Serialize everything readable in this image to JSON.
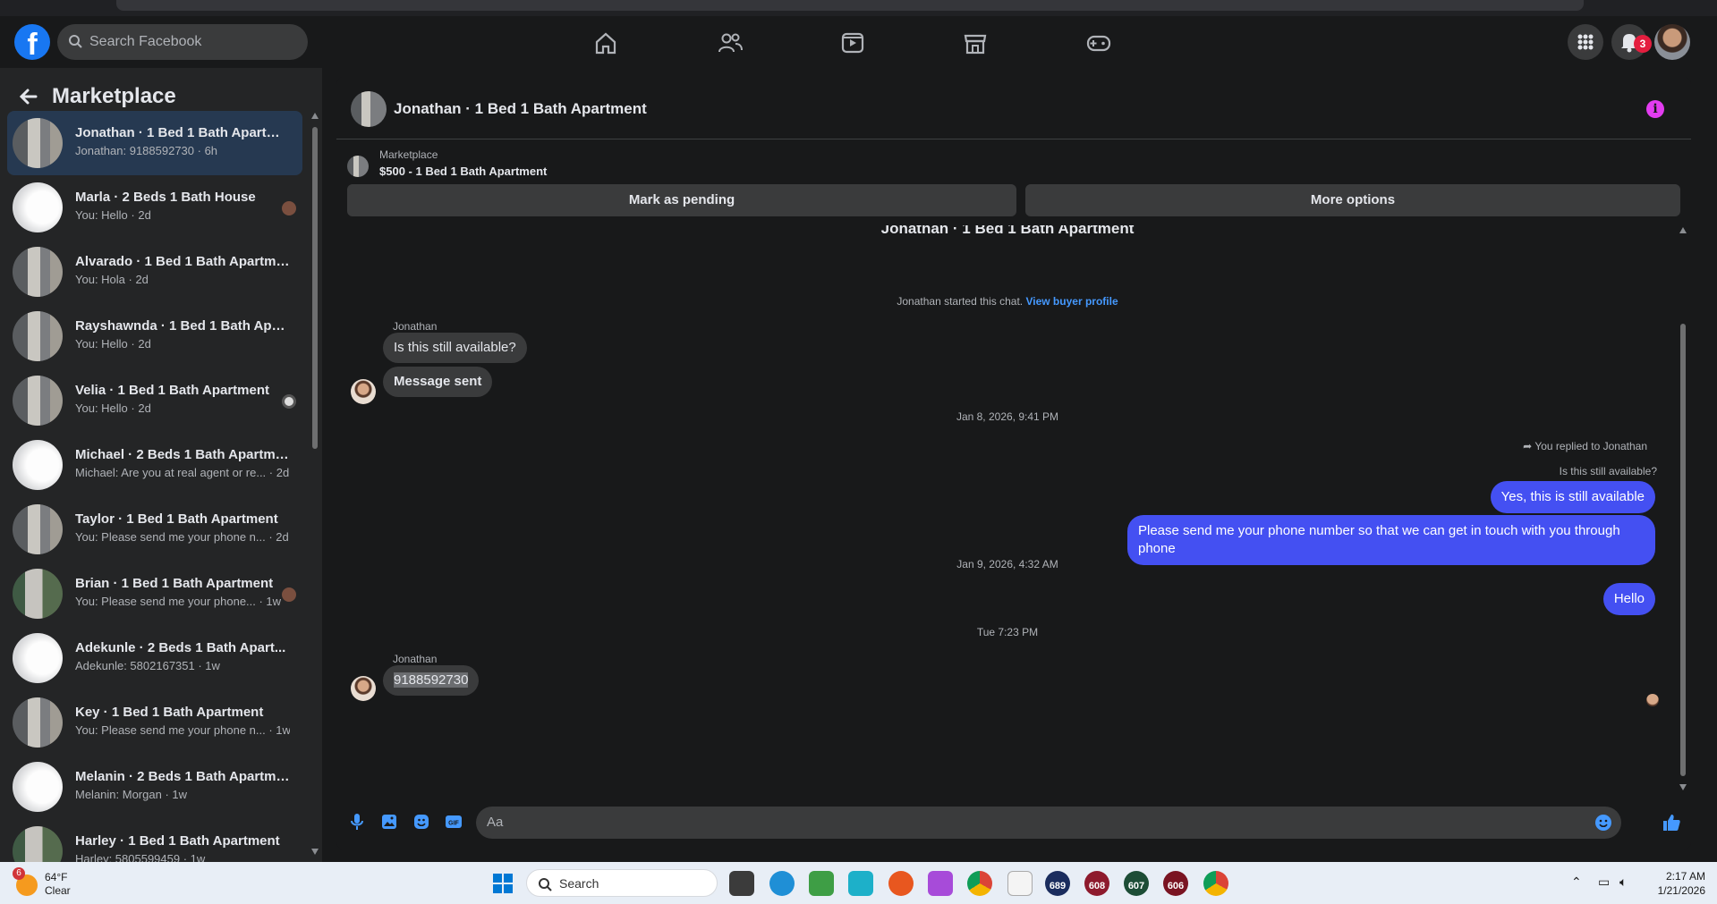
{
  "app": {
    "name": "Facebook Marketplace"
  },
  "topnav": {
    "search_placeholder": "Search Facebook",
    "notifications_count": "3"
  },
  "sidebar": {
    "title": "Marketplace",
    "conversations": [
      {
        "title": "Jonathan · 1 Bed 1 Bath Apartme...",
        "sub": "Jonathan: 9188592730 · 6h"
      },
      {
        "title": "Marla · 2 Beds 1 Bath House",
        "sub": "You: Hello · 2d"
      },
      {
        "title": "Alvarado · 1 Bed 1 Bath Apartment",
        "sub": "You: Hola · 2d"
      },
      {
        "title": "Rayshawnda · 1 Bed 1 Bath Apart...",
        "sub": "You: Hello · 2d"
      },
      {
        "title": "Velia · 1 Bed 1 Bath Apartment",
        "sub": "You: Hello · 2d"
      },
      {
        "title": "Michael · 2 Beds 1 Bath Apartme...",
        "sub": "Michael: Are you at real agent or re... · 2d"
      },
      {
        "title": "Taylor · 1 Bed 1 Bath Apartment",
        "sub": "You: Please send me your phone n... · 2d"
      },
      {
        "title": "Brian · 1 Bed 1 Bath Apartment",
        "sub": "You: Please send me your phone... · 1w"
      },
      {
        "title": "Adekunle · 2 Beds 1 Bath Apart...",
        "sub": "Adekunle: 5802167351 · 1w"
      },
      {
        "title": "Key · 1 Bed 1 Bath Apartment",
        "sub": "You: Please send me your phone n... · 1w"
      },
      {
        "title": "Melanin · 2 Beds 1 Bath Apartme...",
        "sub": "Melanin: Morgan · 1w"
      },
      {
        "title": "Harley · 1 Bed 1 Bath Apartment",
        "sub": "Harley: 5805599459 · 1w"
      }
    ]
  },
  "chat": {
    "header_title": "Jonathan · 1 Bed 1 Bath Apartment",
    "listing_label": "Marketplace",
    "listing_title": "$500 - 1 Bed 1 Bath Apartment",
    "mark_pending": "Mark as pending",
    "more_options": "More options",
    "top_title": "Jonathan · 1 Bed 1 Bath Apartment",
    "started_text": "Jonathan started this chat.",
    "view_profile": "View buyer profile",
    "sender1": "Jonathan",
    "msg1": "Is this still available?",
    "msg2": "Message sent",
    "ts1": "Jan 8, 2026, 9:41 PM",
    "replied_to": "You replied to Jonathan",
    "quoted": "Is this still available?",
    "out1": "Yes, this is still available",
    "out2": "Please send me your phone  number so that we can get in touch with you through phone",
    "ts2": "Jan 9, 2026, 4:32 AM",
    "out3": "Hello",
    "ts3": "Tue 7:23 PM",
    "sender2": "Jonathan",
    "msg3": "9188592730",
    "composer_placeholder": "Aa"
  },
  "taskbar": {
    "weather_badge": "6",
    "temp": "64°F",
    "condition": "Clear",
    "search": "Search",
    "app_nums": [
      "689",
      "608",
      "607",
      "606"
    ],
    "time": "2:17 AM",
    "date": "1/21/2026"
  },
  "colors": {
    "brand": "#1877f2",
    "outgoing_bubble": "#4450f2",
    "link": "#4599ff",
    "info_icon": "#e23cf0"
  }
}
